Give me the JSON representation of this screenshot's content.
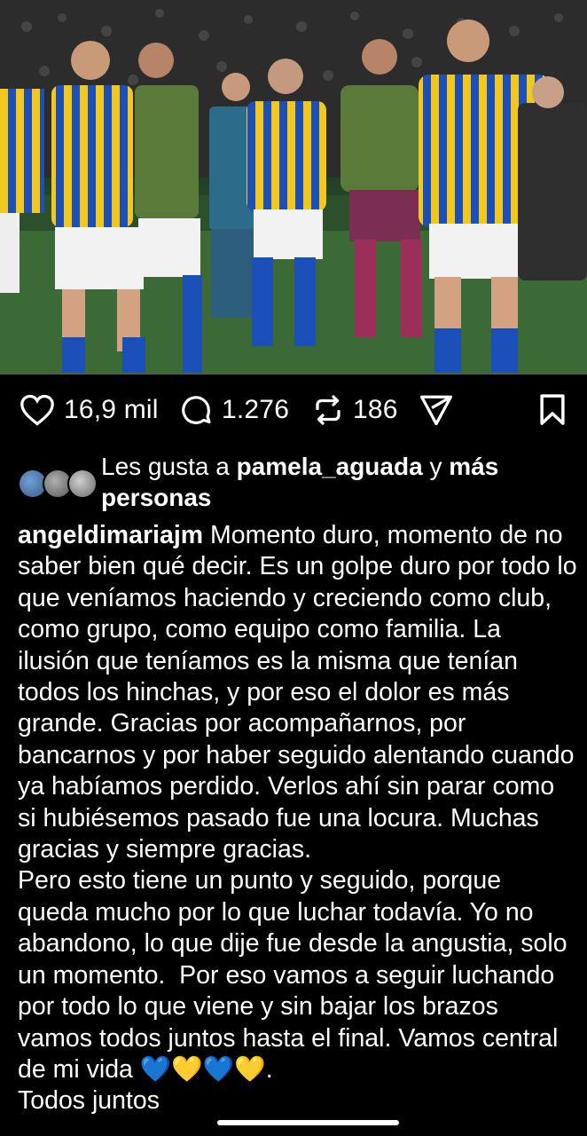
{
  "post": {
    "photo_alt_icon": "photo",
    "actions": {
      "likes": "16,9 mil",
      "comments": "1.276",
      "reposts": "186"
    },
    "liked_by": {
      "prefix": "Les gusta a ",
      "user": "pamela_aguada",
      "middle": " y ",
      "rest": "más personas"
    },
    "caption": {
      "author": "angeldimariajm",
      "paragraph1": " Momento duro, momento de no saber bien qué decir. Es un golpe duro por todo lo que veníamos haciendo y creciendo como club, como grupo, como equipo como familia. La ilusión que teníamos es la misma que tenían todos los hinchas, y por eso el dolor es más grande. Gracias por acompañarnos, por bancarnos y por haber seguido alentando cuando ya habíamos perdido. Verlos ahí sin parar como si hubiésemos pasado fue una locura. Muchas gracias y siempre gracias.",
      "paragraph2": "Pero esto tiene un punto y seguido, porque queda mucho por lo que luchar todavía. Yo no abandono, lo que dije fue desde la angustia, solo un momento.  Por eso vamos a seguir luchando por todo lo que viene y sin bajar los brazos vamos todos juntos hasta el final. Vamos central de mi vida 💙💛💙💛.",
      "paragraph3": "Todos juntos"
    }
  },
  "colors": {
    "background": "#000000",
    "text": "#ffffff",
    "jersey_blue": "#1d4fb8",
    "jersey_yellow": "#f2c81e",
    "keeper_green": "#5a7a3a"
  }
}
